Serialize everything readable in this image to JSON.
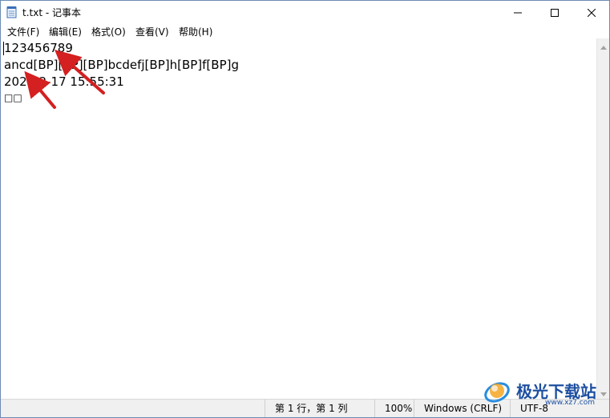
{
  "window": {
    "title": "t.txt - 记事本"
  },
  "menu": {
    "items": [
      {
        "label": "文件(F)"
      },
      {
        "label": "编辑(E)"
      },
      {
        "label": "格式(O)"
      },
      {
        "label": "查看(V)"
      },
      {
        "label": "帮助(H)"
      }
    ]
  },
  "editor": {
    "lines": [
      "123456789",
      "ancd[BP][BP][BP]bcdefj[BP]h[BP]f[BP]g",
      "2023-2-17 15:55:31",
      "□□"
    ]
  },
  "status": {
    "position": "第 1 行，第 1 列",
    "zoom": "100%",
    "line_ending": "Windows (CRLF)",
    "encoding": "UTF-8"
  },
  "watermark": {
    "text": "极光下载站",
    "url": "www.xz7.com"
  },
  "icons": {
    "app": "notepad-icon",
    "minimize": "minimize-icon",
    "maximize": "maximize-icon",
    "close": "close-icon"
  },
  "colors": {
    "annotation_arrow": "#d42020",
    "watermark": "#1d4fa0"
  }
}
